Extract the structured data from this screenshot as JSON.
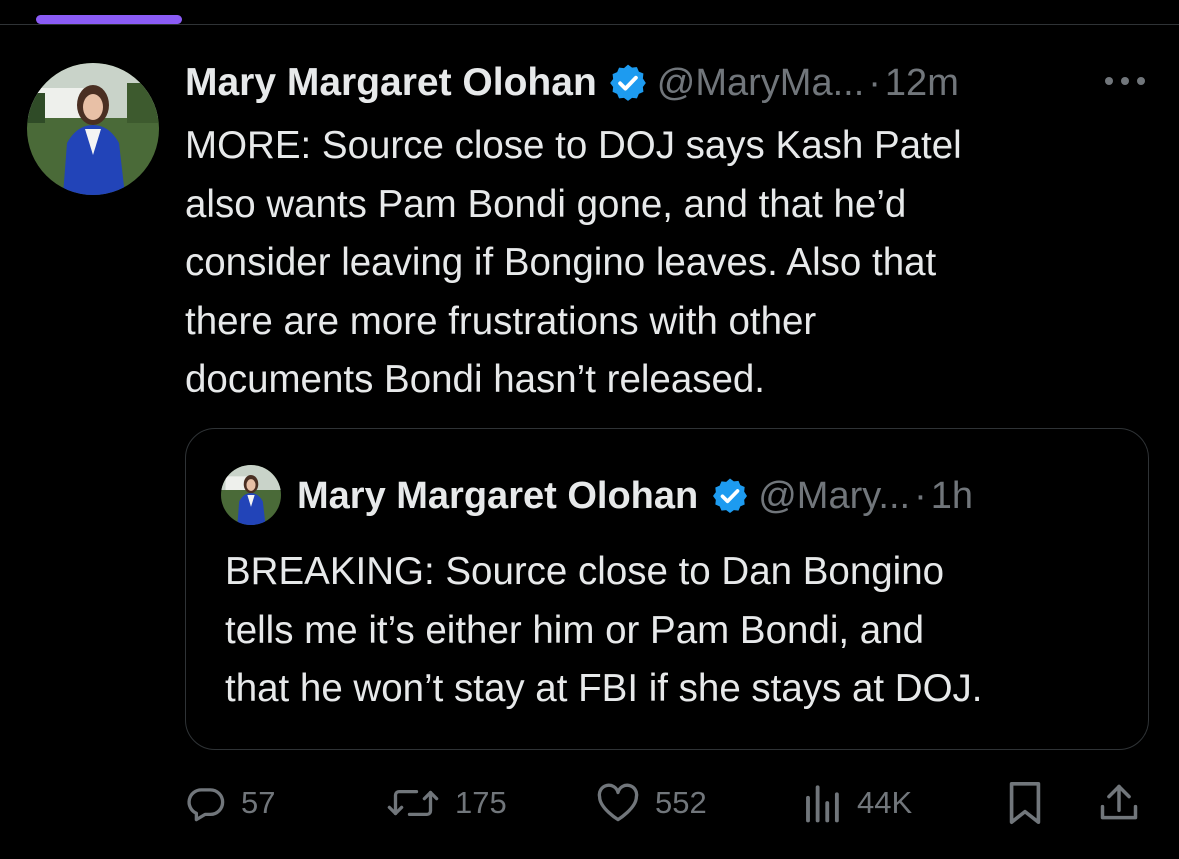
{
  "post": {
    "author_name": "Mary Margaret Olohan",
    "handle": "@MaryMa...",
    "separator": "·",
    "time": "12m",
    "body_lines": [
      "MORE: Source close to DOJ says Kash Patel",
      "also wants Pam Bondi gone, and that he’d",
      "consider leaving if Bongino leaves. Also that",
      "there are more frustrations with other",
      "documents Bondi hasn’t released."
    ]
  },
  "quoted_post": {
    "author_name": "Mary Margaret Olohan",
    "handle": "@Mary...",
    "separator": "·",
    "time": "1h",
    "body_lines": [
      "BREAKING: Source close to Dan Bongino",
      "tells me it’s either him or Pam Bondi, and",
      "that he won’t stay at FBI if she stays at DOJ."
    ]
  },
  "actions": {
    "replies": "57",
    "reposts": "175",
    "likes": "552",
    "views": "44K"
  },
  "icons": {
    "verified": "verified-badge-icon",
    "more": "more-options-icon",
    "reply": "reply-icon",
    "repost": "repost-icon",
    "like": "heart-icon",
    "views": "views-icon",
    "bookmark": "bookmark-icon",
    "share": "share-icon"
  },
  "colors": {
    "background": "#000000",
    "text_primary": "#e7e9ea",
    "text_secondary": "#71767b",
    "verified": "#1d9bf0",
    "tab_indicator": "#8b5cf6",
    "border": "#2f3336"
  }
}
